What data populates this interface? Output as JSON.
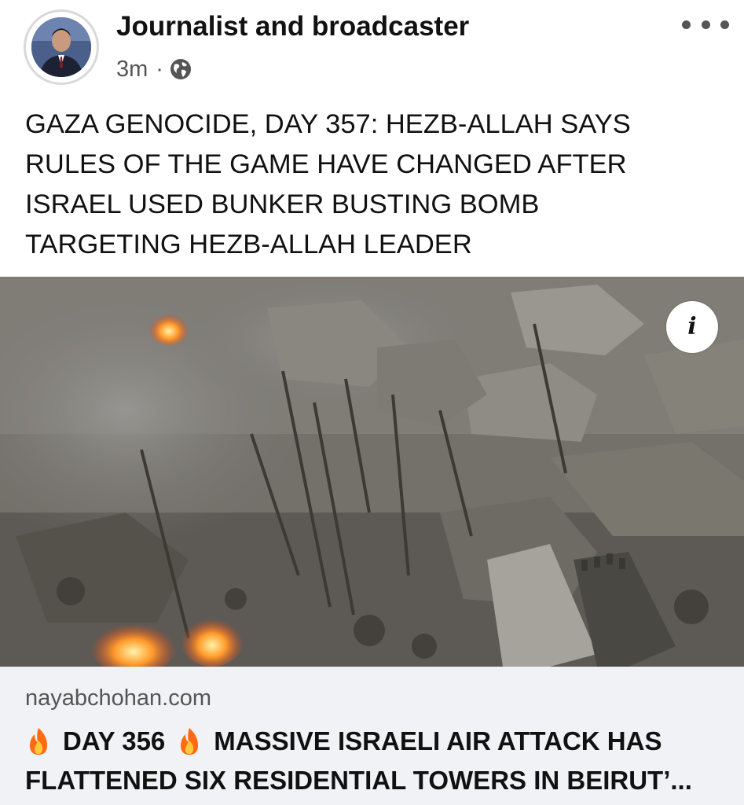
{
  "post": {
    "author_name": "Journalist and broadcaster",
    "timestamp": "3m",
    "separator": "·",
    "audience_icon": "globe-icon",
    "more_icon": "more-options-icon",
    "text_lines": [
      "GAZA GENOCIDE, DAY 357: HEZB-ALLAH SAYS",
      "RULES OF THE GAME HAVE CHANGED AFTER",
      "ISRAEL USED BUNKER BUSTING BOMB",
      "TARGETING HEZB-ALLAH LEADER"
    ]
  },
  "media": {
    "info_label": "i",
    "info_icon": "info-icon"
  },
  "link_preview": {
    "domain": "nayabchohan.com",
    "title_line1_a": "DAY 356",
    "title_line1_b": "MASSIVE ISRAELI AIR ATTACK HAS",
    "title_line2": "FLATTENED SIX RESIDENTIAL TOWERS IN BEIRUT’...",
    "emoji_icon": "fire-icon"
  },
  "colors": {
    "text_primary": "#111111",
    "text_secondary": "#555555",
    "link_preview_bg": "#f0f2f5",
    "fire": "#ff6a13"
  }
}
